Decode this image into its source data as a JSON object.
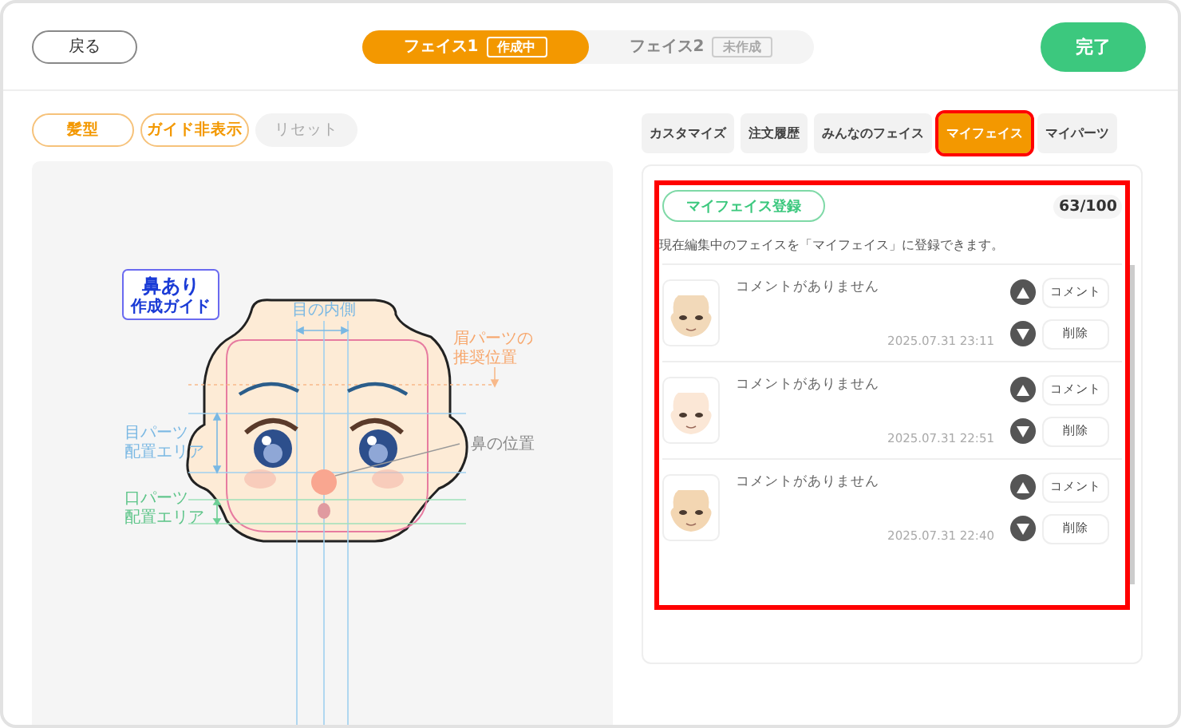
{
  "header": {
    "back_button": "戻る",
    "face_tabs": [
      {
        "label": "フェイス1",
        "status": "作成中",
        "selected": true
      },
      {
        "label": "フェイス2",
        "status": "未作成",
        "selected": false
      }
    ],
    "done_button": "完了"
  },
  "tools": [
    {
      "label": "髪型",
      "disabled": false
    },
    {
      "label": "ガイド非表示",
      "disabled": false
    },
    {
      "label": "リセット",
      "disabled": true
    }
  ],
  "guide": {
    "badge_title": "鼻あり",
    "badge_subtitle": "作成ガイド",
    "eye_inner": "目の内側",
    "brow_area": [
      "眉パーツの",
      "推奨位置"
    ],
    "eye_area": [
      "目パーツ",
      "配置エリア"
    ],
    "nose_position": "鼻の位置",
    "mouth_area": [
      "口パーツ",
      "配置エリア"
    ]
  },
  "panel_tabs": [
    {
      "label": "カスタマイズ",
      "selected": false,
      "highlighted": false
    },
    {
      "label": "注文履歴",
      "selected": false,
      "highlighted": false
    },
    {
      "label": "みんなのフェイス",
      "selected": false,
      "highlighted": false
    },
    {
      "label": "マイフェイス",
      "selected": true,
      "highlighted": true
    },
    {
      "label": "マイパーツ",
      "selected": false,
      "highlighted": false
    }
  ],
  "my_face": {
    "highlighted": true,
    "register_button": "マイフェイス登録",
    "count": "63/100",
    "description": "現在編集中のフェイスを「マイフェイス」に登録できます。",
    "items": [
      {
        "color": "#f2d9b9",
        "comment": "コメントがありません",
        "date": "2025.07.31 23:11",
        "comment_button": "コメント",
        "delete_button": "削除"
      },
      {
        "color": "#fbe7d6",
        "comment": "コメントがありません",
        "date": "2025.07.31 22:51",
        "comment_button": "コメント",
        "delete_button": "削除"
      },
      {
        "color": "#f3d6b2",
        "comment": "コメントがありません",
        "date": "2025.07.31 22:40",
        "comment_button": "コメント",
        "delete_button": "削除"
      }
    ]
  }
}
